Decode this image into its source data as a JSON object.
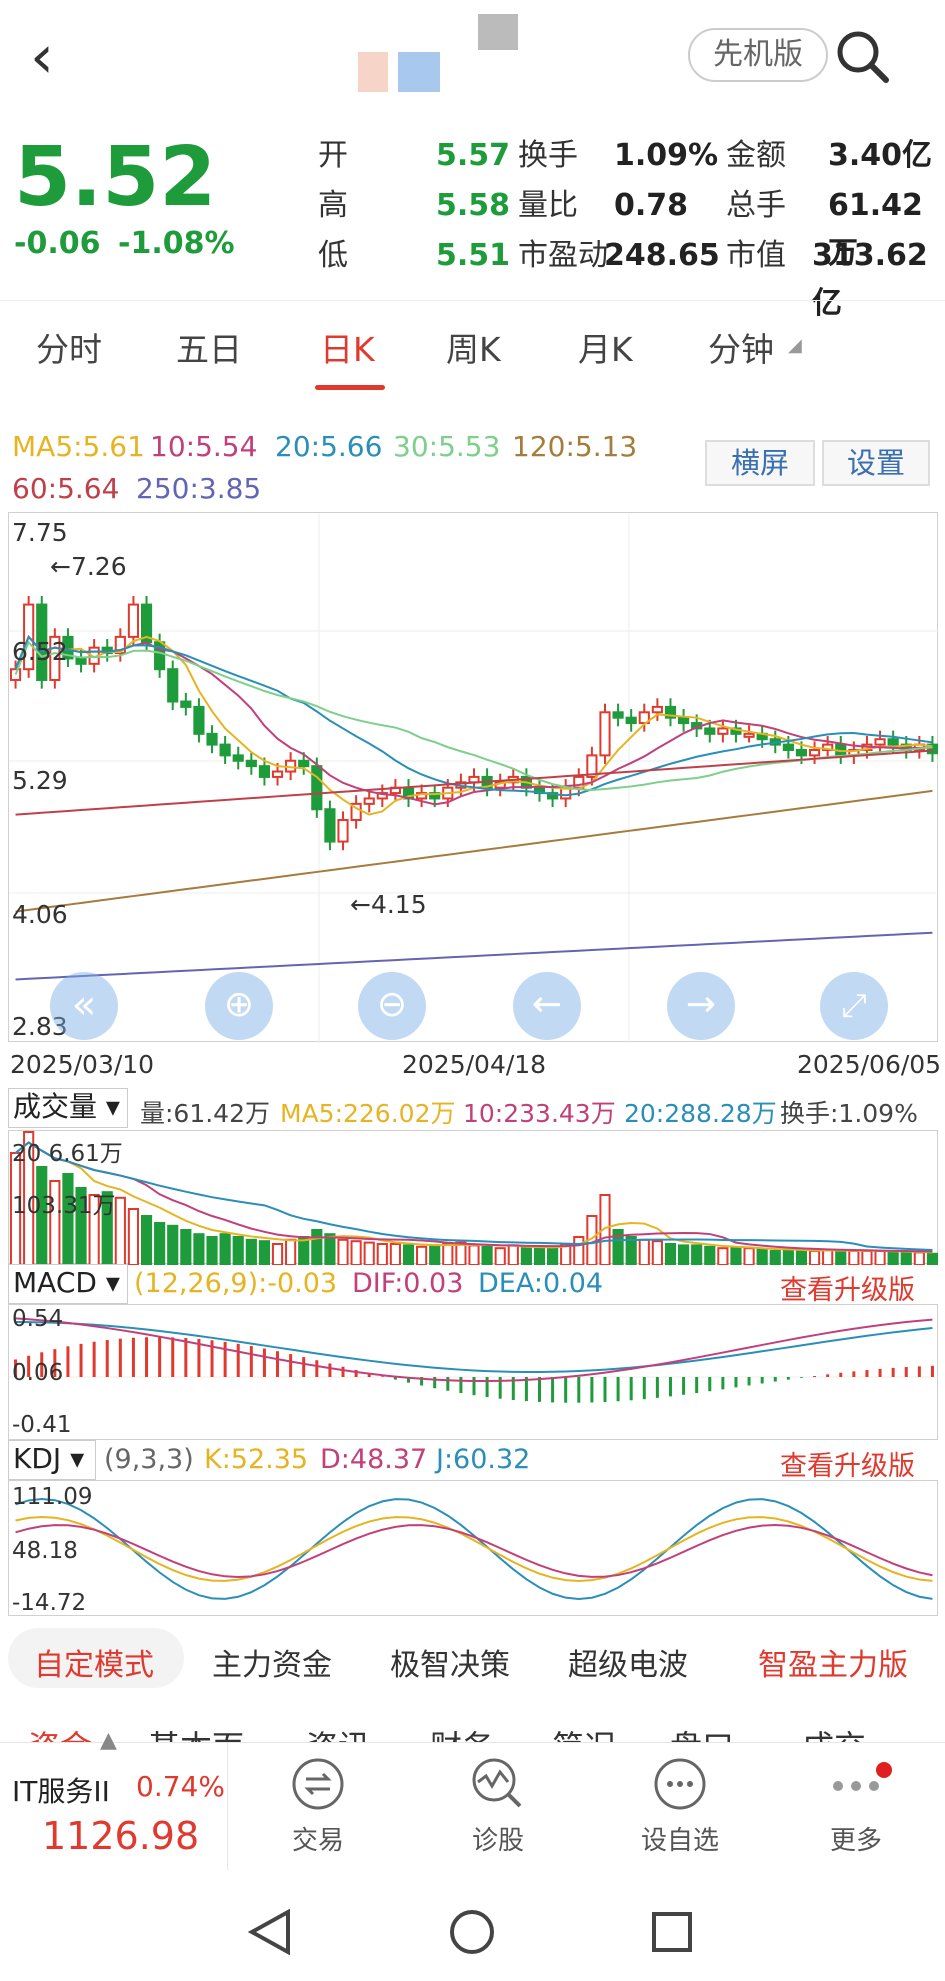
{
  "header": {
    "back_icon": "chevron-left-icon",
    "mode_label": "先机版",
    "search_icon": "search-icon"
  },
  "quote": {
    "price": "5.52",
    "change": "-0.06",
    "change_pct": "-1.08%",
    "rows": [
      {
        "l1": "开",
        "v1": "5.57",
        "l2": "换手",
        "v2": "1.09%",
        "l3": "金额",
        "v3": "3.40亿"
      },
      {
        "l1": "高",
        "v1": "5.58",
        "l2": "量比",
        "v2": "0.78",
        "l3": "总手",
        "v3": "61.42万"
      },
      {
        "l1": "低",
        "v1": "5.51",
        "l2": "市盈动",
        "v2": "248.65",
        "l3": "市值",
        "v3": "313.62亿"
      }
    ]
  },
  "tabs": [
    "分时",
    "五日",
    "日K",
    "周K",
    "月K",
    "分钟"
  ],
  "active_tab": "日K",
  "ma": {
    "ma5": "MA5:5.61",
    "ma10": "10:5.54",
    "ma20": "20:5.66",
    "ma30": "30:5.53",
    "ma120": "120:5.13",
    "ma60": "60:5.64",
    "ma250": "250:3.85"
  },
  "chart_buttons": {
    "landscape": "横屏",
    "settings": "设置"
  },
  "kline": {
    "y_labels": [
      "7.75",
      "6.52",
      "5.29",
      "4.06",
      "2.83"
    ],
    "high_note": "←7.26",
    "low_note": "←4.15",
    "dates": [
      "2025/03/10",
      "2025/04/18",
      "2025/06/05"
    ]
  },
  "volume": {
    "label": "成交量",
    "vol": "量:61.42万",
    "ma5": "MA5:226.02万",
    "ma10": "10:233.43万",
    "ma20": "20:288.28万",
    "turnover": "换手:1.09%",
    "y1": "20 6.61万",
    "y2": "103.31万"
  },
  "macd": {
    "label": "MACD",
    "params": "(12,26,9):-0.03",
    "dif": "DIF:0.03",
    "dea": "DEA:0.04",
    "upgrade": "查看升级版",
    "y": [
      "0.54",
      "0.06",
      "-0.41"
    ]
  },
  "kdj": {
    "label": "KDJ",
    "params": "(9,3,3)",
    "k": "K:52.35",
    "d": "D:48.37",
    "j": "J:60.32",
    "upgrade": "查看升级版",
    "y": [
      "111.09",
      "48.18",
      "-14.72"
    ]
  },
  "mode_tabs": [
    "自定模式",
    "主力资金",
    "极智决策",
    "超级电波",
    "智盈主力版"
  ],
  "sub_tabs": [
    "资金",
    "基本面",
    "资讯",
    "财务",
    "简况",
    "盘口",
    "成交"
  ],
  "bottom": {
    "index_name": "IT服务II",
    "index_pct": "0.74%",
    "index_value": "1126.98",
    "nav": [
      {
        "label": "交易",
        "icon": "exchange-icon"
      },
      {
        "label": "诊股",
        "icon": "diagnose-icon"
      },
      {
        "label": "设自选",
        "icon": "add-watchlist-icon"
      },
      {
        "label": "更多",
        "icon": "more-icon"
      }
    ]
  },
  "colors": {
    "green": "#1e9b3a",
    "red": "#e0392e",
    "ma5": "#e6b422",
    "ma10": "#c2407a",
    "ma20": "#2a8fb8",
    "ma30": "#7fcf8c",
    "ma120": "#a67c3c",
    "ma60": "#c0404a",
    "ma250": "#6464b4"
  }
}
